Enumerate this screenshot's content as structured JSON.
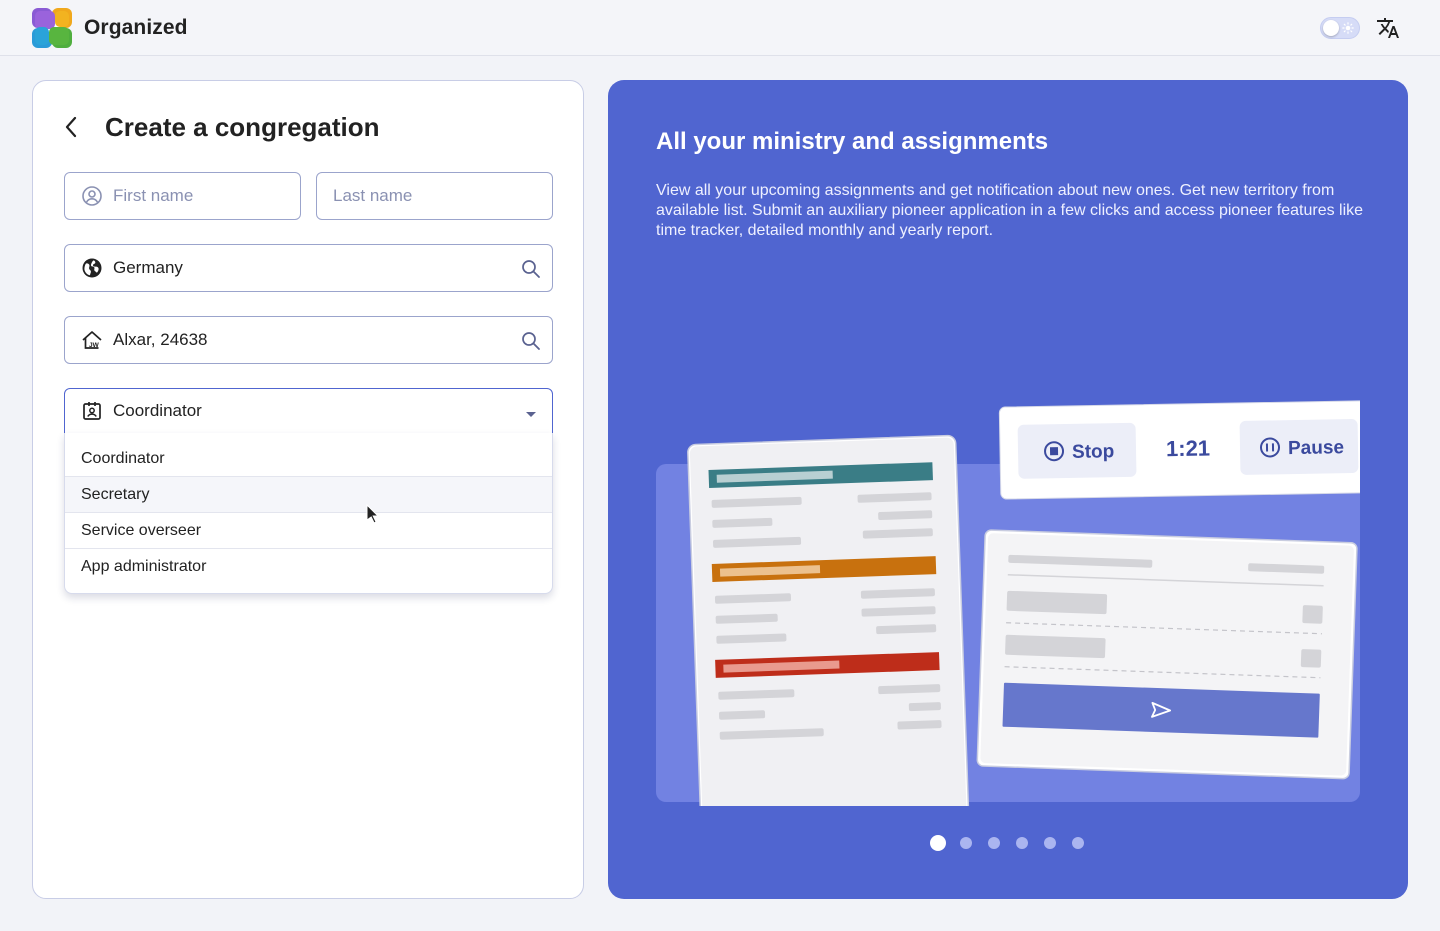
{
  "header": {
    "app_title": "Organized",
    "toggle_icon": "theme-toggle",
    "language_icon": "translate-icon"
  },
  "form": {
    "title": "Create a congregation",
    "first_name_placeholder": "First name",
    "last_name_placeholder": "Last name",
    "country_value": "Germany",
    "congregation_value": "Alxar, 24638",
    "role_value": "Coordinator",
    "role_options": [
      "Coordinator",
      "Secretary",
      "Service overseer",
      "App administrator"
    ]
  },
  "panel": {
    "title": "All your ministry and assignments",
    "description": "View all your upcoming assignments and get notification about new ones. Get new territory from available list. Submit an auxiliary pioneer application in a few clicks and access pioneer features like time tracker, detailed monthly and yearly report.",
    "timer": {
      "stop_label": "Stop",
      "time": "1:21",
      "pause_label": "Pause"
    },
    "slides_count": 6,
    "active_slide": 0
  },
  "colors": {
    "accent": "#5065d0",
    "teal": "#3a7d86",
    "orange": "#c8710e",
    "red": "#be2d1a"
  }
}
